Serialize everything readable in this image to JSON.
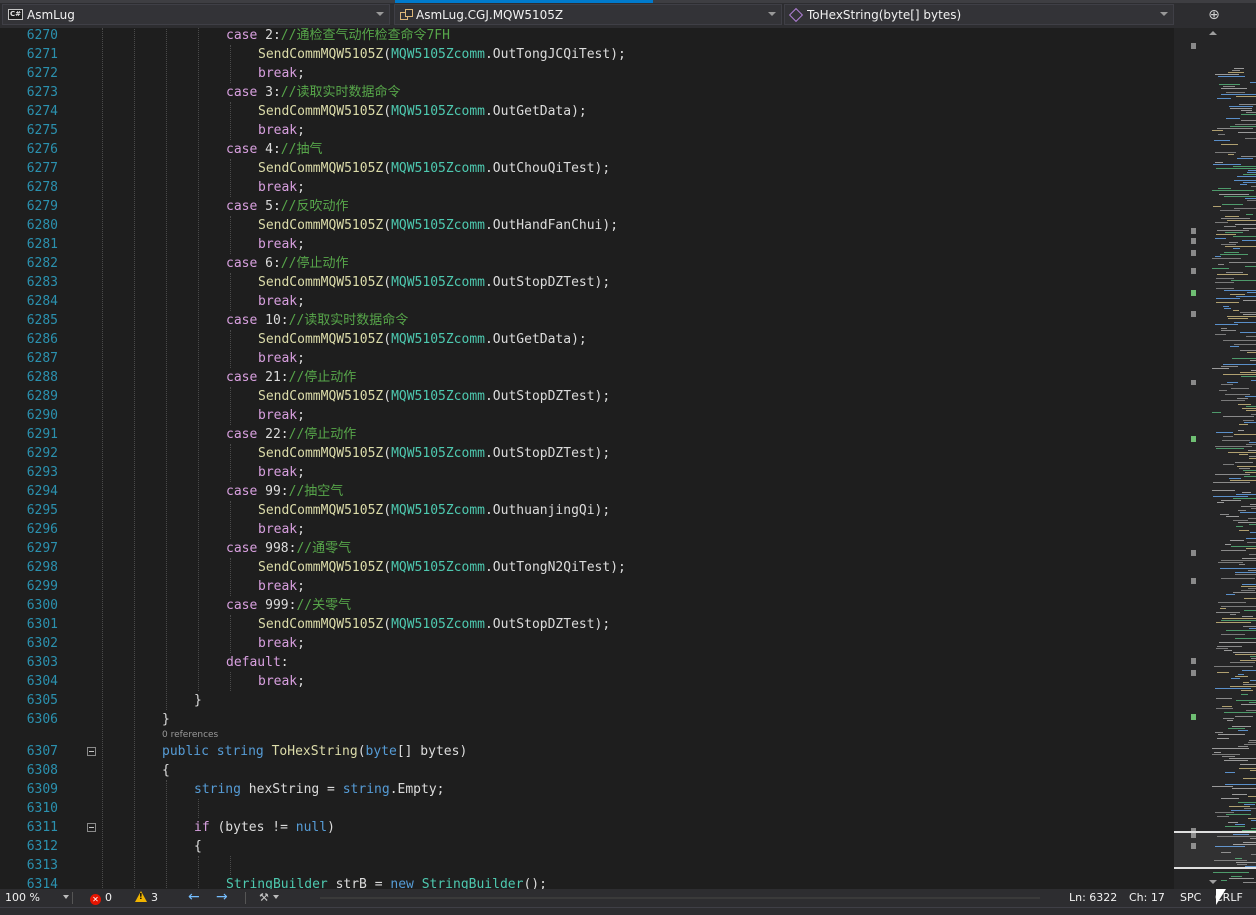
{
  "navbar": {
    "project": "AsmLug",
    "type": "AsmLug.CGJ.MQW5105Z",
    "member": "ToHexString(byte[] bytes)"
  },
  "lines": [
    {
      "n": "6270",
      "indent": 4,
      "tokens": [
        {
          "t": "case",
          "c": "ct"
        },
        {
          "t": " 2:",
          "c": "df"
        },
        {
          "t": "//通检查气动作检查命令7FH",
          "c": "cm"
        }
      ]
    },
    {
      "n": "6271",
      "indent": 5,
      "tokens": [
        {
          "t": "SendCommMQW5105Z",
          "c": "fn"
        },
        {
          "t": "(",
          "c": "df"
        },
        {
          "t": "MQW5105Zcomm",
          "c": "ty"
        },
        {
          "t": ".OutTongJCQiTest);",
          "c": "df"
        }
      ]
    },
    {
      "n": "6272",
      "indent": 5,
      "tokens": [
        {
          "t": "break",
          "c": "ct"
        },
        {
          "t": ";",
          "c": "df"
        }
      ]
    },
    {
      "n": "6273",
      "indent": 4,
      "tokens": [
        {
          "t": "case",
          "c": "ct"
        },
        {
          "t": " 3:",
          "c": "df"
        },
        {
          "t": "//读取实时数据命令",
          "c": "cm"
        }
      ]
    },
    {
      "n": "6274",
      "indent": 5,
      "tokens": [
        {
          "t": "SendCommMQW5105Z",
          "c": "fn"
        },
        {
          "t": "(",
          "c": "df"
        },
        {
          "t": "MQW5105Zcomm",
          "c": "ty"
        },
        {
          "t": ".OutGetData);",
          "c": "df"
        }
      ]
    },
    {
      "n": "6275",
      "indent": 5,
      "tokens": [
        {
          "t": "break",
          "c": "ct"
        },
        {
          "t": ";",
          "c": "df"
        }
      ]
    },
    {
      "n": "6276",
      "indent": 4,
      "tokens": [
        {
          "t": "case",
          "c": "ct"
        },
        {
          "t": " 4:",
          "c": "df"
        },
        {
          "t": "//抽气",
          "c": "cm"
        }
      ]
    },
    {
      "n": "6277",
      "indent": 5,
      "tokens": [
        {
          "t": "SendCommMQW5105Z",
          "c": "fn"
        },
        {
          "t": "(",
          "c": "df"
        },
        {
          "t": "MQW5105Zcomm",
          "c": "ty"
        },
        {
          "t": ".OutChouQiTest);",
          "c": "df"
        }
      ]
    },
    {
      "n": "6278",
      "indent": 5,
      "tokens": [
        {
          "t": "break",
          "c": "ct"
        },
        {
          "t": ";",
          "c": "df"
        }
      ]
    },
    {
      "n": "6279",
      "indent": 4,
      "tokens": [
        {
          "t": "case",
          "c": "ct"
        },
        {
          "t": " 5:",
          "c": "df"
        },
        {
          "t": "//反吹动作",
          "c": "cm"
        }
      ]
    },
    {
      "n": "6280",
      "indent": 5,
      "tokens": [
        {
          "t": "SendCommMQW5105Z",
          "c": "fn"
        },
        {
          "t": "(",
          "c": "df"
        },
        {
          "t": "MQW5105Zcomm",
          "c": "ty"
        },
        {
          "t": ".OutHandFanChui);",
          "c": "df"
        }
      ]
    },
    {
      "n": "6281",
      "indent": 5,
      "tokens": [
        {
          "t": "break",
          "c": "ct"
        },
        {
          "t": ";",
          "c": "df"
        }
      ]
    },
    {
      "n": "6282",
      "indent": 4,
      "tokens": [
        {
          "t": "case",
          "c": "ct"
        },
        {
          "t": " 6:",
          "c": "df"
        },
        {
          "t": "//停止动作",
          "c": "cm"
        }
      ]
    },
    {
      "n": "6283",
      "indent": 5,
      "tokens": [
        {
          "t": "SendCommMQW5105Z",
          "c": "fn"
        },
        {
          "t": "(",
          "c": "df"
        },
        {
          "t": "MQW5105Zcomm",
          "c": "ty"
        },
        {
          "t": ".OutStopDZTest);",
          "c": "df"
        }
      ]
    },
    {
      "n": "6284",
      "indent": 5,
      "tokens": [
        {
          "t": "break",
          "c": "ct"
        },
        {
          "t": ";",
          "c": "df"
        }
      ]
    },
    {
      "n": "6285",
      "indent": 4,
      "tokens": [
        {
          "t": "case",
          "c": "ct"
        },
        {
          "t": " 10:",
          "c": "df"
        },
        {
          "t": "//读取实时数据命令",
          "c": "cm"
        }
      ]
    },
    {
      "n": "6286",
      "indent": 5,
      "tokens": [
        {
          "t": "SendCommMQW5105Z",
          "c": "fn"
        },
        {
          "t": "(",
          "c": "df"
        },
        {
          "t": "MQW5105Zcomm",
          "c": "ty"
        },
        {
          "t": ".OutGetData);",
          "c": "df"
        }
      ]
    },
    {
      "n": "6287",
      "indent": 5,
      "tokens": [
        {
          "t": "break",
          "c": "ct"
        },
        {
          "t": ";",
          "c": "df"
        }
      ]
    },
    {
      "n": "6288",
      "indent": 4,
      "tokens": [
        {
          "t": "case",
          "c": "ct"
        },
        {
          "t": " 21:",
          "c": "df"
        },
        {
          "t": "//停止动作",
          "c": "cm"
        }
      ]
    },
    {
      "n": "6289",
      "indent": 5,
      "tokens": [
        {
          "t": "SendCommMQW5105Z",
          "c": "fn"
        },
        {
          "t": "(",
          "c": "df"
        },
        {
          "t": "MQW5105Zcomm",
          "c": "ty"
        },
        {
          "t": ".OutStopDZTest);",
          "c": "df"
        }
      ]
    },
    {
      "n": "6290",
      "indent": 5,
      "tokens": [
        {
          "t": "break",
          "c": "ct"
        },
        {
          "t": ";",
          "c": "df"
        }
      ]
    },
    {
      "n": "6291",
      "indent": 4,
      "tokens": [
        {
          "t": "case",
          "c": "ct"
        },
        {
          "t": " 22:",
          "c": "df"
        },
        {
          "t": "//停止动作",
          "c": "cm"
        }
      ]
    },
    {
      "n": "6292",
      "indent": 5,
      "tokens": [
        {
          "t": "SendCommMQW5105Z",
          "c": "fn"
        },
        {
          "t": "(",
          "c": "df"
        },
        {
          "t": "MQW5105Zcomm",
          "c": "ty"
        },
        {
          "t": ".OutStopDZTest);",
          "c": "df"
        }
      ]
    },
    {
      "n": "6293",
      "indent": 5,
      "tokens": [
        {
          "t": "break",
          "c": "ct"
        },
        {
          "t": ";",
          "c": "df"
        }
      ]
    },
    {
      "n": "6294",
      "indent": 4,
      "tokens": [
        {
          "t": "case",
          "c": "ct"
        },
        {
          "t": " 99:",
          "c": "df"
        },
        {
          "t": "//抽空气",
          "c": "cm"
        }
      ]
    },
    {
      "n": "6295",
      "indent": 5,
      "tokens": [
        {
          "t": "SendCommMQW5105Z",
          "c": "fn"
        },
        {
          "t": "(",
          "c": "df"
        },
        {
          "t": "MQW5105Zcomm",
          "c": "ty"
        },
        {
          "t": ".OuthuanjingQi);",
          "c": "df"
        }
      ]
    },
    {
      "n": "6296",
      "indent": 5,
      "tokens": [
        {
          "t": "break",
          "c": "ct"
        },
        {
          "t": ";",
          "c": "df"
        }
      ]
    },
    {
      "n": "6297",
      "indent": 4,
      "tokens": [
        {
          "t": "case",
          "c": "ct"
        },
        {
          "t": " 998:",
          "c": "df"
        },
        {
          "t": "//通零气",
          "c": "cm"
        }
      ]
    },
    {
      "n": "6298",
      "indent": 5,
      "tokens": [
        {
          "t": "SendCommMQW5105Z",
          "c": "fn"
        },
        {
          "t": "(",
          "c": "df"
        },
        {
          "t": "MQW5105Zcomm",
          "c": "ty"
        },
        {
          "t": ".OutTongN2QiTest);",
          "c": "df"
        }
      ]
    },
    {
      "n": "6299",
      "indent": 5,
      "tokens": [
        {
          "t": "break",
          "c": "ct"
        },
        {
          "t": ";",
          "c": "df"
        }
      ]
    },
    {
      "n": "6300",
      "indent": 4,
      "tokens": [
        {
          "t": "case",
          "c": "ct"
        },
        {
          "t": " 999:",
          "c": "df"
        },
        {
          "t": "//关零气",
          "c": "cm"
        }
      ]
    },
    {
      "n": "6301",
      "indent": 5,
      "tokens": [
        {
          "t": "SendCommMQW5105Z",
          "c": "fn"
        },
        {
          "t": "(",
          "c": "df"
        },
        {
          "t": "MQW5105Zcomm",
          "c": "ty"
        },
        {
          "t": ".OutStopDZTest);",
          "c": "df"
        }
      ]
    },
    {
      "n": "6302",
      "indent": 5,
      "tokens": [
        {
          "t": "break",
          "c": "ct"
        },
        {
          "t": ";",
          "c": "df"
        }
      ]
    },
    {
      "n": "6303",
      "indent": 4,
      "tokens": [
        {
          "t": "default",
          "c": "ct"
        },
        {
          "t": ":",
          "c": "df"
        }
      ]
    },
    {
      "n": "6304",
      "indent": 5,
      "tokens": [
        {
          "t": "break",
          "c": "ct"
        },
        {
          "t": ";",
          "c": "df"
        }
      ]
    },
    {
      "n": "6305",
      "indent": 3,
      "tokens": [
        {
          "t": "}",
          "c": "df"
        }
      ]
    },
    {
      "n": "6306",
      "indent": 2,
      "tokens": [
        {
          "t": "}",
          "c": "df"
        }
      ]
    },
    {
      "n": "",
      "indent": 2,
      "lens": "0 references",
      "tokens": []
    },
    {
      "n": "6307",
      "indent": 2,
      "fold": true,
      "tokens": [
        {
          "t": "public",
          "c": "kw"
        },
        {
          "t": " ",
          "c": "df"
        },
        {
          "t": "string",
          "c": "kw"
        },
        {
          "t": " ",
          "c": "df"
        },
        {
          "t": "ToHexString",
          "c": "fn"
        },
        {
          "t": "(",
          "c": "df"
        },
        {
          "t": "byte",
          "c": "kw"
        },
        {
          "t": "[] bytes)",
          "c": "df"
        }
      ]
    },
    {
      "n": "6308",
      "indent": 2,
      "tokens": [
        {
          "t": "{",
          "c": "df"
        }
      ]
    },
    {
      "n": "6309",
      "indent": 3,
      "tokens": [
        {
          "t": "string",
          "c": "kw"
        },
        {
          "t": " hexString = ",
          "c": "df"
        },
        {
          "t": "string",
          "c": "kw"
        },
        {
          "t": ".Empty;",
          "c": "df"
        }
      ]
    },
    {
      "n": "6310",
      "indent": 3,
      "tokens": []
    },
    {
      "n": "6311",
      "indent": 3,
      "fold": true,
      "tokens": [
        {
          "t": "if",
          "c": "ct"
        },
        {
          "t": " (bytes != ",
          "c": "df"
        },
        {
          "t": "null",
          "c": "kw"
        },
        {
          "t": ")",
          "c": "df"
        }
      ]
    },
    {
      "n": "6312",
      "indent": 3,
      "tokens": [
        {
          "t": "{",
          "c": "df"
        }
      ]
    },
    {
      "n": "6313",
      "indent": 4,
      "tokens": []
    },
    {
      "n": "6314",
      "indent": 4,
      "tokens": [
        {
          "t": "StringBuilder",
          "c": "ty"
        },
        {
          "t": " strB = ",
          "c": "df"
        },
        {
          "t": "new",
          "c": "kw"
        },
        {
          "t": " ",
          "c": "df"
        },
        {
          "t": "StringBuilder",
          "c": "ty"
        },
        {
          "t": "();",
          "c": "df"
        }
      ]
    }
  ],
  "statusbar": {
    "zoom": "100 %",
    "errors": "0",
    "warnings": "3",
    "line": "Ln: 6322",
    "col": "Ch: 17",
    "spacing": "SPC",
    "eol": "CRLF"
  }
}
